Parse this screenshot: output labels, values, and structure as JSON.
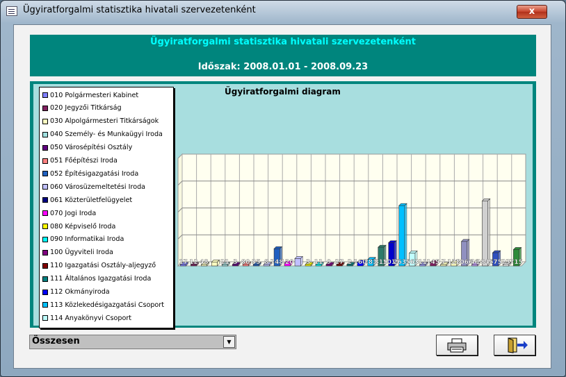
{
  "window": {
    "title": "Ügyiratforgalmi statisztika hivatali szervezetenként",
    "close_glyph": "x"
  },
  "header": {
    "title": "Ügyiratforgalmi statisztika hivatali szervezetenként",
    "period": "Időszak: 2008.01.01 - 2008.09.23"
  },
  "chart_data": {
    "type": "bar",
    "title": "Ügyiratforgalmi diagram",
    "legend_position": "left",
    "legend": [
      {
        "label": "010 Polgármesteri Kabinet",
        "color": "#8080ff"
      },
      {
        "label": "020 Jegyzői Titkárság",
        "color": "#802060"
      },
      {
        "label": "030 Alpolgármesteri Titkárságok",
        "color": "#ffffc0"
      },
      {
        "label": "040 Személy- és Munkaügyi Iroda",
        "color": "#a0e0e0"
      },
      {
        "label": "050 Városépítési Osztály",
        "color": "#600080"
      },
      {
        "label": "051 Főépítészi Iroda",
        "color": "#ff8080"
      },
      {
        "label": "052 Építésigazgatási Iroda",
        "color": "#2060c0"
      },
      {
        "label": "060 Városüzemeltetési Iroda",
        "color": "#c0c0ff"
      },
      {
        "label": "061 Közterületfelügyelet",
        "color": "#000080"
      },
      {
        "label": "070 Jogi Iroda",
        "color": "#ff00ff"
      },
      {
        "label": "080 Képviselő Iroda",
        "color": "#ffff00"
      },
      {
        "label": "090 Informatikai Iroda",
        "color": "#00ffff"
      },
      {
        "label": "100 Ügyviteli Iroda",
        "color": "#800080"
      },
      {
        "label": "110 Igazgatási Osztály-aljegyző",
        "color": "#800000"
      },
      {
        "label": "111 Általános Igazgatási Iroda",
        "color": "#008080"
      },
      {
        "label": "112 Okmányiroda",
        "color": "#0000ff"
      },
      {
        "label": "113 Közlekedésigazgatási Csoport",
        "color": "#00c0ff"
      },
      {
        "label": "114 Anyakönyvi Csoport",
        "color": "#c0ffff"
      }
    ],
    "bars": [
      {
        "label": "17",
        "value": 17,
        "color": "#8080ff"
      },
      {
        "label": "12",
        "value": 12,
        "color": "#802060"
      },
      {
        "label": "48",
        "value": 48,
        "color": "#ffffc0"
      },
      {
        "label": "",
        "value": 170,
        "color": "#ffffc0"
      },
      {
        "label": "21",
        "value": 21,
        "color": "#a0e0e0"
      },
      {
        "label": "3",
        "value": 3,
        "color": "#600080"
      },
      {
        "label": "80",
        "value": 80,
        "color": "#ff8080"
      },
      {
        "label": "35",
        "value": 35,
        "color": "#2060c0"
      },
      {
        "label": "8",
        "value": 8,
        "color": "#c0c0ff"
      },
      {
        "label": "748",
        "value": 748,
        "color": "#2060c0"
      },
      {
        "label": "120",
        "value": 120,
        "color": "#ff00ff"
      },
      {
        "label": "",
        "value": 320,
        "color": "#c0c0ff"
      },
      {
        "label": "3",
        "value": 3,
        "color": "#ffff00"
      },
      {
        "label": "11",
        "value": 11,
        "color": "#00ffff"
      },
      {
        "label": "9",
        "value": 9,
        "color": "#800080"
      },
      {
        "label": "27",
        "value": 27,
        "color": "#800000"
      },
      {
        "label": "2",
        "value": 2,
        "color": "#008080"
      },
      {
        "label": "160",
        "value": 160,
        "color": "#0000ff"
      },
      {
        "label": "281",
        "value": 281,
        "color": "#00c0ff"
      },
      {
        "label": "815",
        "value": 815,
        "color": "#2e7a6a"
      },
      {
        "label": "1012",
        "value": 1012,
        "color": "#0000cc"
      },
      {
        "label": "2632",
        "value": 2632,
        "color": "#00c0ff"
      },
      {
        "label": "563",
        "value": 563,
        "color": "#c0ffff"
      },
      {
        "label": "11",
        "value": 11,
        "color": "#a0a0ff"
      },
      {
        "label": "145",
        "value": 145,
        "color": "#802060"
      },
      {
        "label": "7",
        "value": 7,
        "color": "#ffffc0"
      },
      {
        "label": "128",
        "value": 128,
        "color": "#ffffc0"
      },
      {
        "label": "1066",
        "value": 1066,
        "color": "#9090c0"
      },
      {
        "label": "46",
        "value": 46,
        "color": "#c8a0ff"
      },
      {
        "label": "2840",
        "value": 2840,
        "color": "#d0d0d0"
      },
      {
        "label": "575",
        "value": 575,
        "color": "#3050c0"
      },
      {
        "label": "23",
        "value": 23,
        "color": "#ffffff"
      },
      {
        "label": "715",
        "value": 715,
        "color": "#2e8b3a"
      }
    ]
  },
  "footer": {
    "combo_value": "Összesen",
    "combo_arrow": "▼",
    "print_button": "print-icon",
    "exit_button": "exit-door-icon"
  }
}
